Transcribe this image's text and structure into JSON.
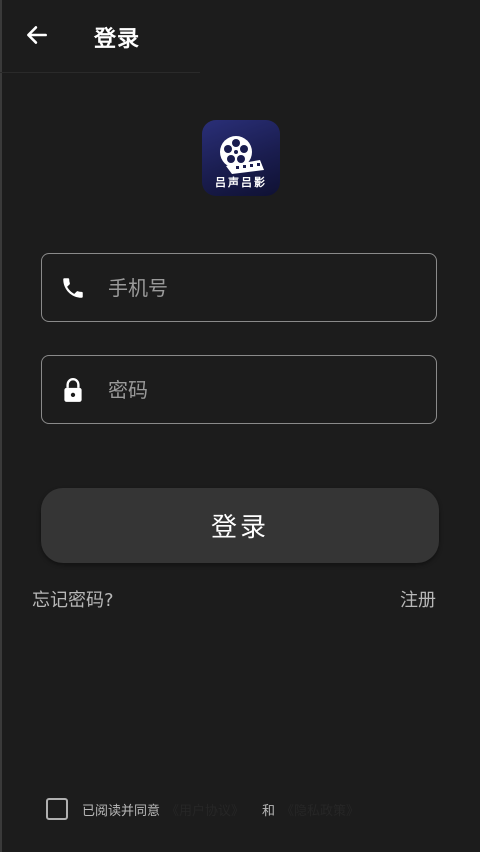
{
  "header": {
    "title": "登录"
  },
  "logo": {
    "text": "吕声吕影"
  },
  "form": {
    "phone_placeholder": "手机号",
    "password_placeholder": "密码",
    "login_label": "登录"
  },
  "links": {
    "forgot": "忘记密码?",
    "register": "注册"
  },
  "agreement": {
    "prefix": "已阅读并同意",
    "user_agreement": "《用户协议》",
    "and": "和",
    "privacy_policy": "《隐私政策》"
  },
  "colors": {
    "background": "#1c1c1c",
    "button": "#353535",
    "logo_bg": "#1a1d4f"
  }
}
